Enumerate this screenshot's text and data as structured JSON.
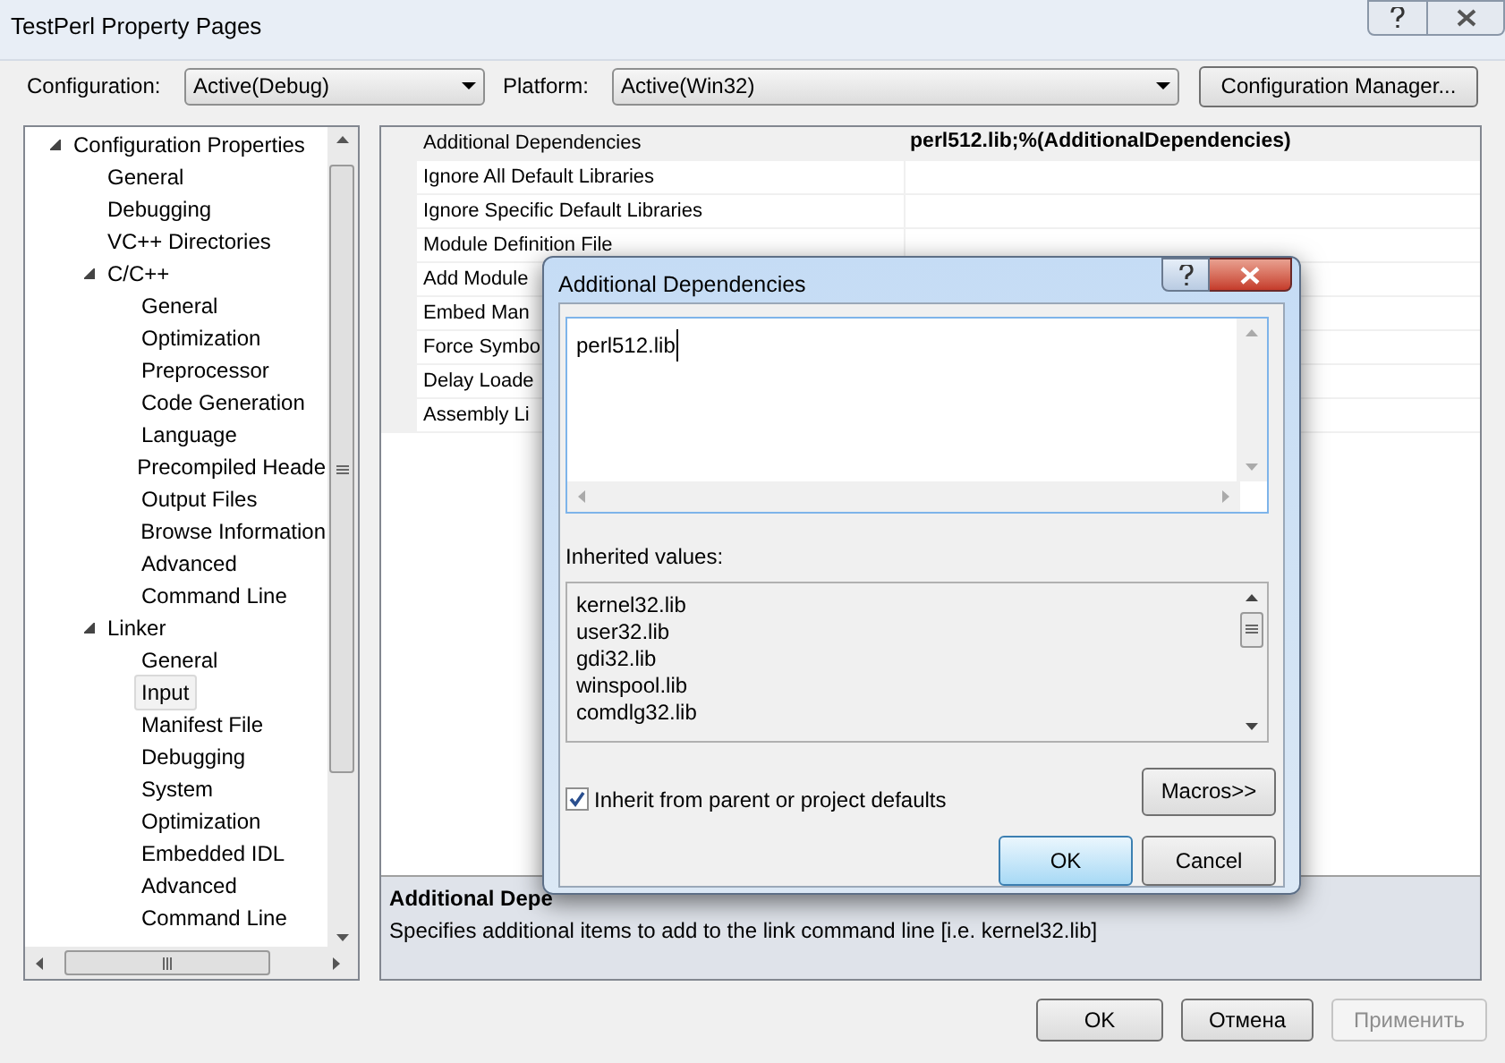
{
  "window": {
    "title": "TestPerl Property Pages"
  },
  "configuration": {
    "label": "Configuration:",
    "value": "Active(Debug)"
  },
  "platform": {
    "label": "Platform:",
    "value": "Active(Win32)"
  },
  "configuration_manager_button": "Configuration Manager...",
  "tree": [
    {
      "label": "Configuration Properties",
      "expanded": true,
      "selected": false,
      "children": [
        {
          "label": "General",
          "selected": false
        },
        {
          "label": "Debugging",
          "selected": false
        },
        {
          "label": "VC++ Directories",
          "selected": false
        },
        {
          "label": "C/C++",
          "expanded": true,
          "selected": false,
          "children": [
            {
              "label": "General",
              "selected": false
            },
            {
              "label": "Optimization",
              "selected": false
            },
            {
              "label": "Preprocessor",
              "selected": false
            },
            {
              "label": "Code Generation",
              "selected": false
            },
            {
              "label": "Language",
              "selected": false
            },
            {
              "label": "Precompiled Heade",
              "selected": false
            },
            {
              "label": "Output Files",
              "selected": false
            },
            {
              "label": "Browse Information",
              "selected": false
            },
            {
              "label": "Advanced",
              "selected": false
            },
            {
              "label": "Command Line",
              "selected": false
            }
          ]
        },
        {
          "label": "Linker",
          "expanded": true,
          "selected": false,
          "children": [
            {
              "label": "General",
              "selected": false
            },
            {
              "label": "Input",
              "selected": true
            },
            {
              "label": "Manifest File",
              "selected": false
            },
            {
              "label": "Debugging",
              "selected": false
            },
            {
              "label": "System",
              "selected": false
            },
            {
              "label": "Optimization",
              "selected": false
            },
            {
              "label": "Embedded IDL",
              "selected": false
            },
            {
              "label": "Advanced",
              "selected": false
            },
            {
              "label": "Command Line",
              "selected": false
            }
          ]
        }
      ]
    }
  ],
  "properties": [
    {
      "name": "Additional Dependencies",
      "value": "perl512.lib;%(AdditionalDependencies)",
      "selected": true
    },
    {
      "name": "Ignore All Default Libraries",
      "selected": false
    },
    {
      "name": "Ignore Specific Default Libraries",
      "selected": false
    },
    {
      "name": "Module Definition File",
      "selected": false
    },
    {
      "name": "Add Module",
      "selected": false
    },
    {
      "name": "Embed Man",
      "selected": false
    },
    {
      "name": "Force Symbo",
      "selected": false
    },
    {
      "name": "Delay Loade",
      "selected": false
    },
    {
      "name": "Assembly Li",
      "selected": false
    }
  ],
  "description": {
    "title": "Additional Depe",
    "text": "Specifies additional items to add to the link command line [i.e. kernel32.lib]"
  },
  "buttons": [
    {
      "label": "OK",
      "disabled": false
    },
    {
      "label": "Отмена",
      "disabled": false
    },
    {
      "label": "Применить",
      "disabled": true
    }
  ],
  "dialog": {
    "title": "Additional Dependencies",
    "value": "perl512.lib",
    "inherited_label": "Inherited values:",
    "inherited": [
      "kernel32.lib",
      "user32.lib",
      "gdi32.lib",
      "winspool.lib",
      "comdlg32.lib"
    ],
    "inherit_checkbox": {
      "label": "Inherit from parent or project defaults",
      "checked": true
    },
    "macros_button": "Macros>>",
    "ok_button": "OK",
    "cancel_button": "Cancel"
  }
}
